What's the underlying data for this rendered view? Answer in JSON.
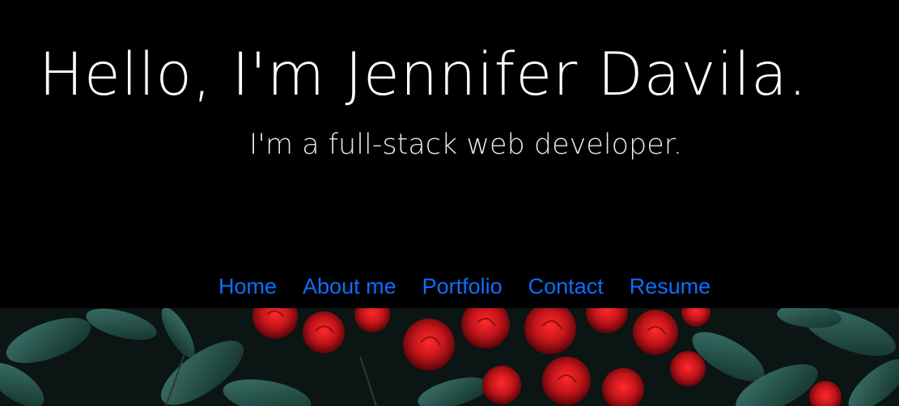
{
  "hero": {
    "title": "Hello, I'm Jennifer Davila.",
    "subtitle": "I'm a full-stack web developer."
  },
  "nav": {
    "items": [
      {
        "label": "Home"
      },
      {
        "label": "About me"
      },
      {
        "label": "Portfolio"
      },
      {
        "label": "Contact"
      },
      {
        "label": "Resume"
      }
    ]
  },
  "colors": {
    "background": "#000000",
    "title": "#ffffff",
    "nav_link": "#0d6efd",
    "rose": "#c3151b",
    "leaf": "#1f4f47"
  }
}
